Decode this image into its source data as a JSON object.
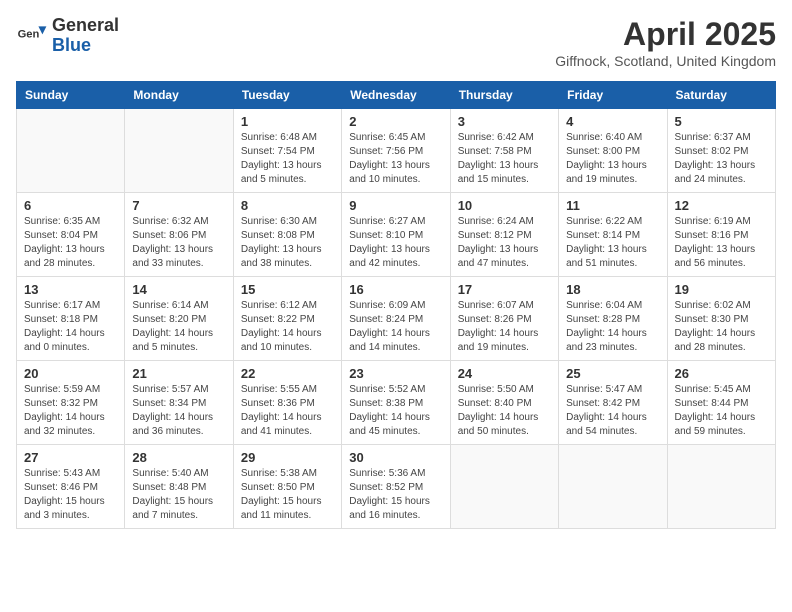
{
  "logo": {
    "general": "General",
    "blue": "Blue"
  },
  "title": "April 2025",
  "location": "Giffnock, Scotland, United Kingdom",
  "headers": [
    "Sunday",
    "Monday",
    "Tuesday",
    "Wednesday",
    "Thursday",
    "Friday",
    "Saturday"
  ],
  "weeks": [
    [
      {
        "day": "",
        "info": ""
      },
      {
        "day": "",
        "info": ""
      },
      {
        "day": "1",
        "info": "Sunrise: 6:48 AM\nSunset: 7:54 PM\nDaylight: 13 hours and 5 minutes."
      },
      {
        "day": "2",
        "info": "Sunrise: 6:45 AM\nSunset: 7:56 PM\nDaylight: 13 hours and 10 minutes."
      },
      {
        "day": "3",
        "info": "Sunrise: 6:42 AM\nSunset: 7:58 PM\nDaylight: 13 hours and 15 minutes."
      },
      {
        "day": "4",
        "info": "Sunrise: 6:40 AM\nSunset: 8:00 PM\nDaylight: 13 hours and 19 minutes."
      },
      {
        "day": "5",
        "info": "Sunrise: 6:37 AM\nSunset: 8:02 PM\nDaylight: 13 hours and 24 minutes."
      }
    ],
    [
      {
        "day": "6",
        "info": "Sunrise: 6:35 AM\nSunset: 8:04 PM\nDaylight: 13 hours and 28 minutes."
      },
      {
        "day": "7",
        "info": "Sunrise: 6:32 AM\nSunset: 8:06 PM\nDaylight: 13 hours and 33 minutes."
      },
      {
        "day": "8",
        "info": "Sunrise: 6:30 AM\nSunset: 8:08 PM\nDaylight: 13 hours and 38 minutes."
      },
      {
        "day": "9",
        "info": "Sunrise: 6:27 AM\nSunset: 8:10 PM\nDaylight: 13 hours and 42 minutes."
      },
      {
        "day": "10",
        "info": "Sunrise: 6:24 AM\nSunset: 8:12 PM\nDaylight: 13 hours and 47 minutes."
      },
      {
        "day": "11",
        "info": "Sunrise: 6:22 AM\nSunset: 8:14 PM\nDaylight: 13 hours and 51 minutes."
      },
      {
        "day": "12",
        "info": "Sunrise: 6:19 AM\nSunset: 8:16 PM\nDaylight: 13 hours and 56 minutes."
      }
    ],
    [
      {
        "day": "13",
        "info": "Sunrise: 6:17 AM\nSunset: 8:18 PM\nDaylight: 14 hours and 0 minutes."
      },
      {
        "day": "14",
        "info": "Sunrise: 6:14 AM\nSunset: 8:20 PM\nDaylight: 14 hours and 5 minutes."
      },
      {
        "day": "15",
        "info": "Sunrise: 6:12 AM\nSunset: 8:22 PM\nDaylight: 14 hours and 10 minutes."
      },
      {
        "day": "16",
        "info": "Sunrise: 6:09 AM\nSunset: 8:24 PM\nDaylight: 14 hours and 14 minutes."
      },
      {
        "day": "17",
        "info": "Sunrise: 6:07 AM\nSunset: 8:26 PM\nDaylight: 14 hours and 19 minutes."
      },
      {
        "day": "18",
        "info": "Sunrise: 6:04 AM\nSunset: 8:28 PM\nDaylight: 14 hours and 23 minutes."
      },
      {
        "day": "19",
        "info": "Sunrise: 6:02 AM\nSunset: 8:30 PM\nDaylight: 14 hours and 28 minutes."
      }
    ],
    [
      {
        "day": "20",
        "info": "Sunrise: 5:59 AM\nSunset: 8:32 PM\nDaylight: 14 hours and 32 minutes."
      },
      {
        "day": "21",
        "info": "Sunrise: 5:57 AM\nSunset: 8:34 PM\nDaylight: 14 hours and 36 minutes."
      },
      {
        "day": "22",
        "info": "Sunrise: 5:55 AM\nSunset: 8:36 PM\nDaylight: 14 hours and 41 minutes."
      },
      {
        "day": "23",
        "info": "Sunrise: 5:52 AM\nSunset: 8:38 PM\nDaylight: 14 hours and 45 minutes."
      },
      {
        "day": "24",
        "info": "Sunrise: 5:50 AM\nSunset: 8:40 PM\nDaylight: 14 hours and 50 minutes."
      },
      {
        "day": "25",
        "info": "Sunrise: 5:47 AM\nSunset: 8:42 PM\nDaylight: 14 hours and 54 minutes."
      },
      {
        "day": "26",
        "info": "Sunrise: 5:45 AM\nSunset: 8:44 PM\nDaylight: 14 hours and 59 minutes."
      }
    ],
    [
      {
        "day": "27",
        "info": "Sunrise: 5:43 AM\nSunset: 8:46 PM\nDaylight: 15 hours and 3 minutes."
      },
      {
        "day": "28",
        "info": "Sunrise: 5:40 AM\nSunset: 8:48 PM\nDaylight: 15 hours and 7 minutes."
      },
      {
        "day": "29",
        "info": "Sunrise: 5:38 AM\nSunset: 8:50 PM\nDaylight: 15 hours and 11 minutes."
      },
      {
        "day": "30",
        "info": "Sunrise: 5:36 AM\nSunset: 8:52 PM\nDaylight: 15 hours and 16 minutes."
      },
      {
        "day": "",
        "info": ""
      },
      {
        "day": "",
        "info": ""
      },
      {
        "day": "",
        "info": ""
      }
    ]
  ]
}
